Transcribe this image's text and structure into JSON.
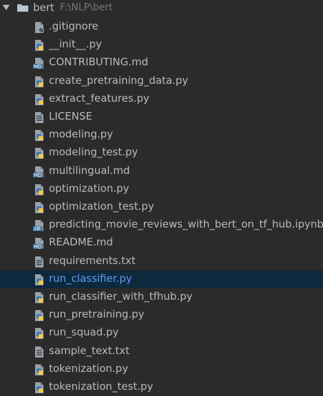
{
  "project": {
    "name": "bert",
    "path": "F:\\NLP\\bert"
  },
  "files": [
    {
      "name": ".gitignore",
      "icon": "gitignore-icon"
    },
    {
      "name": "__init__.py",
      "icon": "python-file-icon"
    },
    {
      "name": "CONTRIBUTING.md",
      "icon": "markdown-file-icon"
    },
    {
      "name": "create_pretraining_data.py",
      "icon": "python-file-icon"
    },
    {
      "name": "extract_features.py",
      "icon": "python-file-icon"
    },
    {
      "name": "LICENSE",
      "icon": "text-file-icon"
    },
    {
      "name": "modeling.py",
      "icon": "python-file-icon"
    },
    {
      "name": "modeling_test.py",
      "icon": "python-file-icon"
    },
    {
      "name": "multilingual.md",
      "icon": "markdown-file-icon"
    },
    {
      "name": "optimization.py",
      "icon": "python-file-icon"
    },
    {
      "name": "optimization_test.py",
      "icon": "python-file-icon"
    },
    {
      "name": "predicting_movie_reviews_with_bert_on_tf_hub.ipynb",
      "icon": "notebook-file-icon"
    },
    {
      "name": "README.md",
      "icon": "markdown-file-icon"
    },
    {
      "name": "requirements.txt",
      "icon": "text-file-icon"
    },
    {
      "name": "run_classifier.py",
      "icon": "python-file-icon",
      "selected": true
    },
    {
      "name": "run_classifier_with_tfhub.py",
      "icon": "python-file-icon"
    },
    {
      "name": "run_pretraining.py",
      "icon": "python-file-icon"
    },
    {
      "name": "run_squad.py",
      "icon": "python-file-icon"
    },
    {
      "name": "sample_text.txt",
      "icon": "text-file-icon"
    },
    {
      "name": "tokenization.py",
      "icon": "python-file-icon"
    },
    {
      "name": "tokenization_test.py",
      "icon": "python-file-icon"
    }
  ],
  "colors": {
    "background": "#2b2b2b",
    "text": "#bbbbbb",
    "path_text": "#787878",
    "selected_background": "#0d293e",
    "selected_text": "#589df6",
    "python_blue": "#3d7ab8",
    "python_yellow": "#f2c94c",
    "markdown_badge": "#3d6b8f",
    "notebook_badge": "#4a7fb0"
  }
}
